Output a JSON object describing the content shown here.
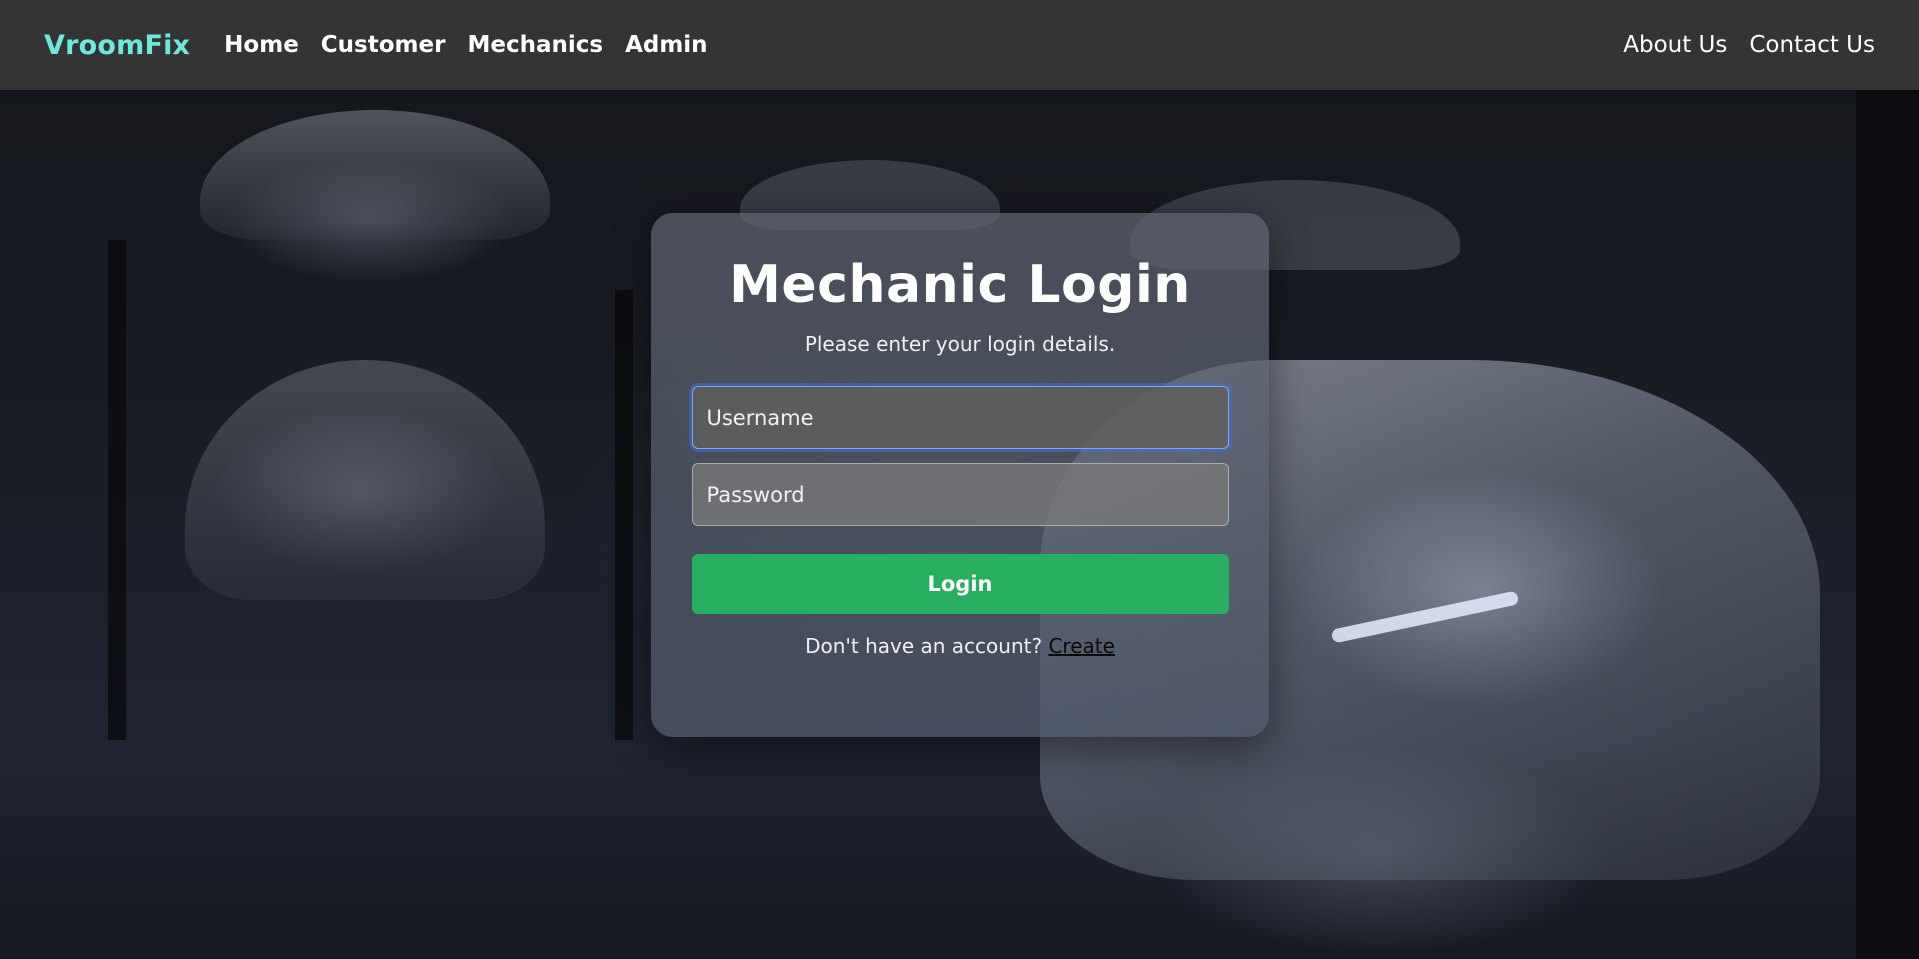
{
  "nav": {
    "brand": "VroomFix",
    "left_links": [
      "Home",
      "Customer",
      "Mechanics",
      "Admin"
    ],
    "right_links": [
      "About Us",
      "Contact Us"
    ]
  },
  "login": {
    "title": "Mechanic Login",
    "subtitle": "Please enter your login details.",
    "username_placeholder": "Username",
    "password_placeholder": "Password",
    "button_label": "Login",
    "signup_prompt": "Don't have an account?",
    "signup_link": "Create"
  },
  "colors": {
    "brand": "#6ee8de",
    "navbar": "#343434",
    "button": "#27ae60"
  }
}
